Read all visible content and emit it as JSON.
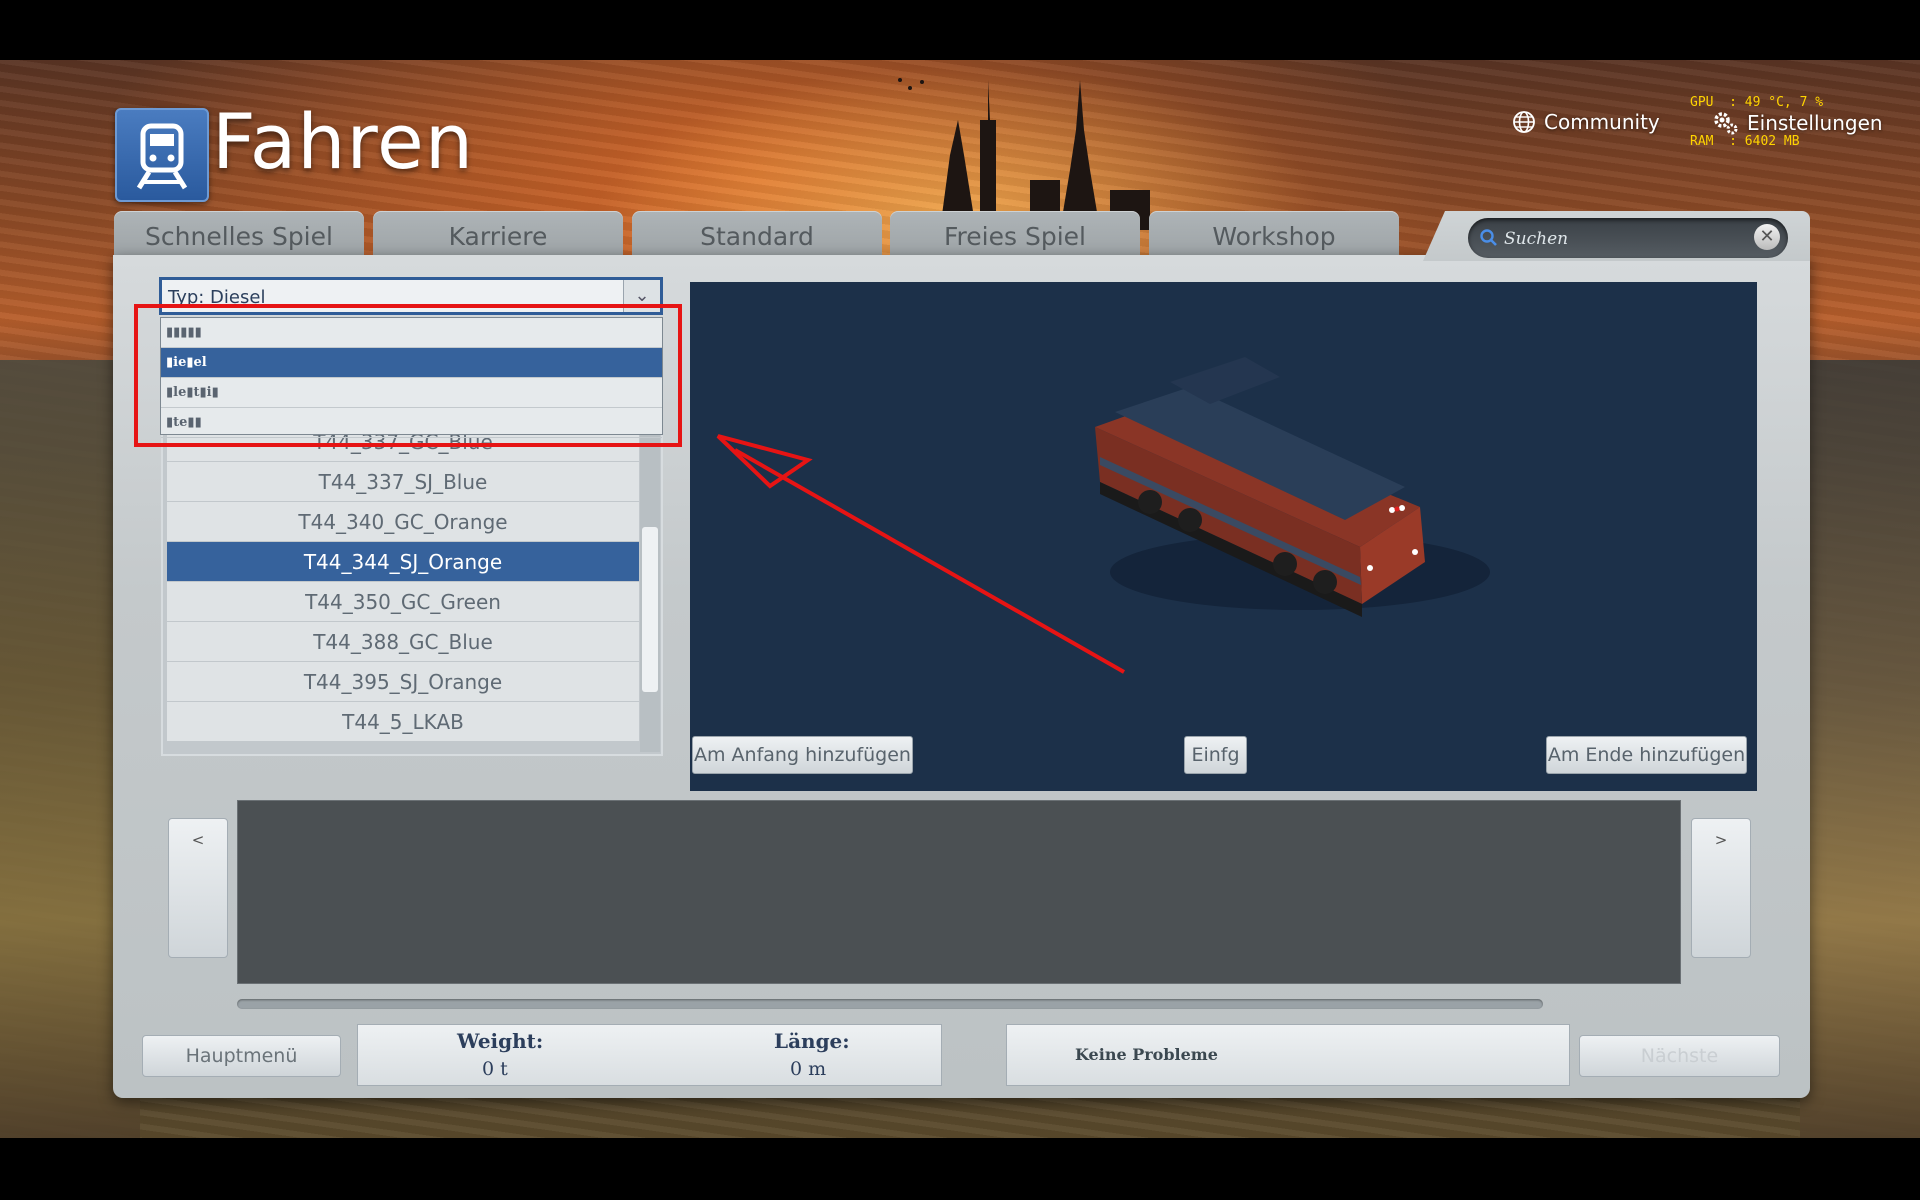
{
  "hud": {
    "line1": "GPU  : 49 °C, 7 %",
    "line2": "RAM  : 6402 MB"
  },
  "header": {
    "title": "Fahren",
    "logo_icon": "train-icon",
    "community_label": "Community",
    "settings_label": "Einstellungen"
  },
  "tabs": [
    {
      "label": "Schnelles Spiel"
    },
    {
      "label": "Karriere"
    },
    {
      "label": "Standard"
    },
    {
      "label": "Freies Spiel"
    },
    {
      "label": "Workshop"
    }
  ],
  "search": {
    "placeholder": "Suchen",
    "clear_label": "✕"
  },
  "type_filter": {
    "value": "Typ: Diesel",
    "options": [
      {
        "label": "▮▮▮▮▮",
        "selected": false
      },
      {
        "label": "▮ie▮el",
        "selected": true
      },
      {
        "label": "▮le▮t▮i▮",
        "selected": false
      },
      {
        "label": "▮te▮▮",
        "selected": false
      }
    ]
  },
  "loco_list": {
    "items": [
      {
        "label": "T44_337_GC_Blue",
        "selected": false
      },
      {
        "label": "T44_337_SJ_Blue",
        "selected": false
      },
      {
        "label": "T44_340_GC_Orange",
        "selected": false
      },
      {
        "label": "T44_344_SJ_Orange",
        "selected": true
      },
      {
        "label": "T44_350_GC_Green",
        "selected": false
      },
      {
        "label": "T44_388_GC_Blue",
        "selected": false
      },
      {
        "label": "T44_395_SJ_Orange",
        "selected": false
      },
      {
        "label": "T44_5_LKAB",
        "selected": false
      }
    ]
  },
  "preview": {
    "add_start_label": "Am Anfang hinzufügen",
    "insert_label": "Einfg",
    "add_end_label": "Am Ende hinzufügen"
  },
  "consist": {
    "prev_label": "<",
    "next_label": ">"
  },
  "bottom": {
    "main_menu_label": "Hauptmenü",
    "weight_label": "Weight:",
    "weight_value": "0 t",
    "length_label": "Länge:",
    "length_value": "0 m",
    "problems_text": "Keine Probleme",
    "next_label": "Nächste"
  },
  "colors": {
    "accent": "#36629c",
    "annotation": "#e61414",
    "preview_bg": "#1c3049",
    "hud": "#ffd400"
  }
}
